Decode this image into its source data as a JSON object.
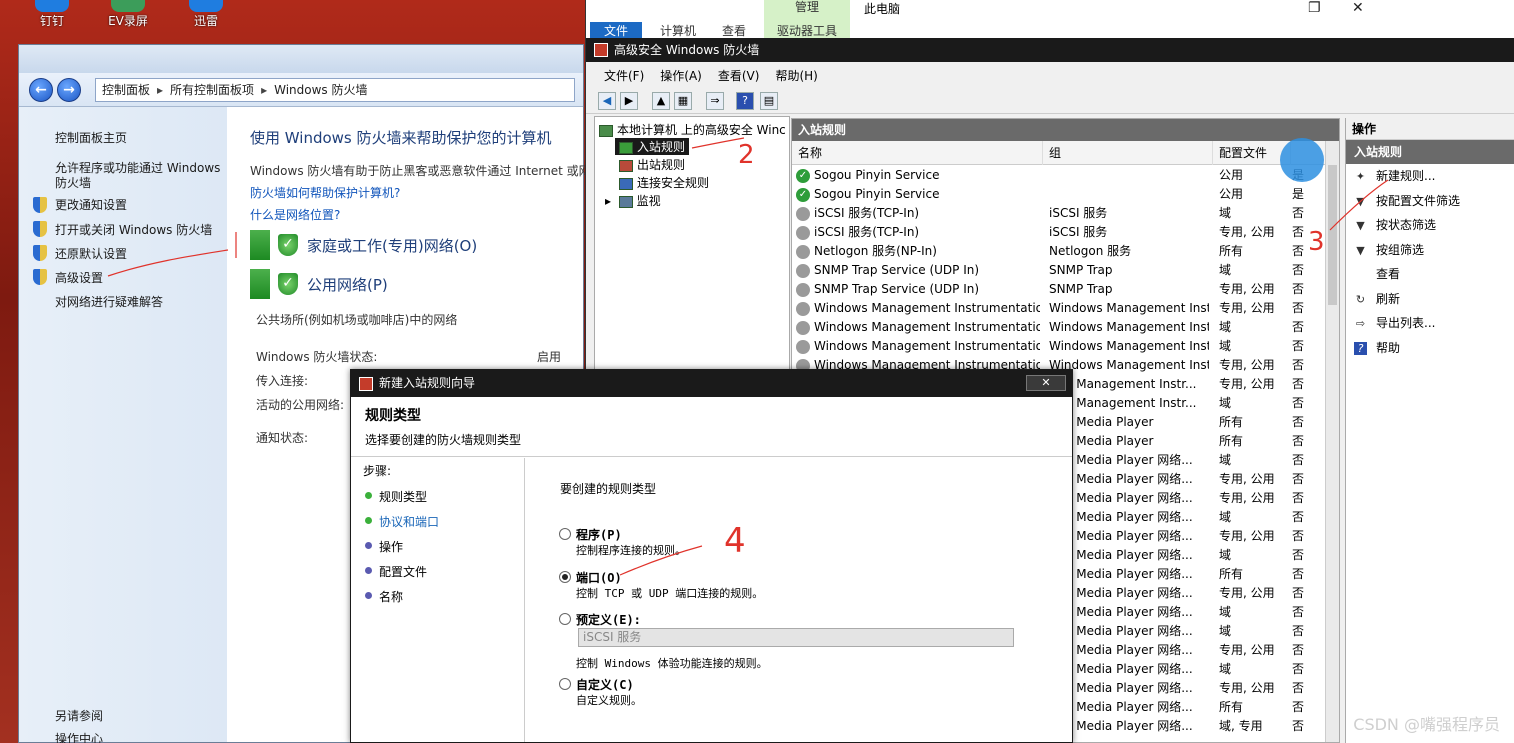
{
  "desktop": {
    "icons": [
      {
        "label": "钉钉"
      },
      {
        "label": "EV录屏"
      },
      {
        "label": "迅雷"
      }
    ]
  },
  "control_panel": {
    "breadcrumb": [
      "控制面板",
      "所有控制面板项",
      "Windows 防火墙"
    ],
    "left_links": [
      {
        "label": "控制面板主页",
        "shield": false
      },
      {
        "label": "允许程序或功能通过 Windows",
        "shield": false
      },
      {
        "label": "防火墙",
        "shield": false
      },
      {
        "label": "更改通知设置",
        "shield": true
      },
      {
        "label": "打开或关闭 Windows 防火墙",
        "shield": true
      },
      {
        "label": "还原默认设置",
        "shield": true
      },
      {
        "label": "高级设置",
        "shield": true
      },
      {
        "label": "对网络进行疑难解答",
        "shield": false
      }
    ],
    "see_also": [
      "另请参阅",
      "操作中心"
    ],
    "heading": "使用 Windows 防火墙来帮助保护您的计算机",
    "intro": "Windows 防火墙有助于防止黑客或恶意软件通过 Internet 或网络",
    "link1": "防火墙如何帮助保护计算机?",
    "link2": "什么是网络位置?",
    "networks": [
      {
        "name": "家庭或工作(专用)网络(O)"
      },
      {
        "name": "公用网络(P)"
      }
    ],
    "public_desc": "公共场所(例如机场或咖啡店)中的网络",
    "status_rows": [
      {
        "label": "Windows 防火墙状态:",
        "value": "启用"
      },
      {
        "label": "传入连接:",
        "value": ""
      },
      {
        "label": "活动的公用网络:",
        "value": ""
      },
      {
        "label": "通知状态:",
        "value": ""
      }
    ]
  },
  "explorer": {
    "tabs": [
      "文件",
      "计算机",
      "查看",
      "驱动器工具"
    ],
    "manage": "管理",
    "title": "此电脑"
  },
  "mmc": {
    "title": "高级安全 Windows 防火墙",
    "menu": [
      "文件(F)",
      "操作(A)",
      "查看(V)",
      "帮助(H)"
    ],
    "tree": {
      "root": "本地计算机 上的高级安全 Winc",
      "items": [
        "入站规则",
        "出站规则",
        "连接安全规则",
        "监视"
      ]
    },
    "list": {
      "title": "入站规则",
      "columns": [
        "名称",
        "组",
        "配置文件",
        ""
      ],
      "rows": [
        {
          "enabled": true,
          "name": "Sogou Pinyin Service",
          "group": "",
          "profile": "公用",
          "on": "是"
        },
        {
          "enabled": true,
          "name": "Sogou Pinyin Service",
          "group": "",
          "profile": "公用",
          "on": "是"
        },
        {
          "enabled": false,
          "name": "iSCSI 服务(TCP-In)",
          "group": "iSCSI 服务",
          "profile": "域",
          "on": "否"
        },
        {
          "enabled": false,
          "name": "iSCSI 服务(TCP-In)",
          "group": "iSCSI 服务",
          "profile": "专用, 公用",
          "on": "否"
        },
        {
          "enabled": false,
          "name": "Netlogon 服务(NP-In)",
          "group": "Netlogon 服务",
          "profile": "所有",
          "on": "否"
        },
        {
          "enabled": false,
          "name": "SNMP Trap Service (UDP In)",
          "group": "SNMP Trap",
          "profile": "域",
          "on": "否"
        },
        {
          "enabled": false,
          "name": "SNMP Trap Service (UDP In)",
          "group": "SNMP Trap",
          "profile": "专用, 公用",
          "on": "否"
        },
        {
          "enabled": false,
          "name": "Windows Management Instrumentation ...",
          "group": "Windows Management Instr...",
          "profile": "专用, 公用",
          "on": "否"
        },
        {
          "enabled": false,
          "name": "Windows Management Instrumentation ...",
          "group": "Windows Management Instr...",
          "profile": "域",
          "on": "否"
        },
        {
          "enabled": false,
          "name": "Windows Management Instrumentation ...",
          "group": "Windows Management Instr...",
          "profile": "域",
          "on": "否"
        },
        {
          "enabled": false,
          "name": "Windows Management Instrumentation ...",
          "group": "Windows Management Instr...",
          "profile": "专用, 公用",
          "on": "否"
        },
        {
          "enabled": false,
          "name": "",
          "group": "ows Management Instr...",
          "profile": "专用, 公用",
          "on": "否"
        },
        {
          "enabled": false,
          "name": "",
          "group": "ows Management Instr...",
          "profile": "域",
          "on": "否"
        },
        {
          "enabled": false,
          "name": "",
          "group": "ows Media Player",
          "profile": "所有",
          "on": "否"
        },
        {
          "enabled": false,
          "name": "",
          "group": "ows Media Player",
          "profile": "所有",
          "on": "否"
        },
        {
          "enabled": false,
          "name": "",
          "group": "ows Media Player 网络...",
          "profile": "域",
          "on": "否"
        },
        {
          "enabled": false,
          "name": "",
          "group": "ows Media Player 网络...",
          "profile": "专用, 公用",
          "on": "否"
        },
        {
          "enabled": false,
          "name": "",
          "group": "ows Media Player 网络...",
          "profile": "专用, 公用",
          "on": "否"
        },
        {
          "enabled": false,
          "name": "",
          "group": "ows Media Player 网络...",
          "profile": "域",
          "on": "否"
        },
        {
          "enabled": false,
          "name": "",
          "group": "ows Media Player 网络...",
          "profile": "专用, 公用",
          "on": "否"
        },
        {
          "enabled": false,
          "name": "",
          "group": "ows Media Player 网络...",
          "profile": "域",
          "on": "否"
        },
        {
          "enabled": false,
          "name": "",
          "group": "ows Media Player 网络...",
          "profile": "所有",
          "on": "否"
        },
        {
          "enabled": false,
          "name": "",
          "group": "ows Media Player 网络...",
          "profile": "专用, 公用",
          "on": "否"
        },
        {
          "enabled": false,
          "name": "",
          "group": "ows Media Player 网络...",
          "profile": "域",
          "on": "否"
        },
        {
          "enabled": false,
          "name": "",
          "group": "ows Media Player 网络...",
          "profile": "域",
          "on": "否"
        },
        {
          "enabled": false,
          "name": "",
          "group": "ows Media Player 网络...",
          "profile": "专用, 公用",
          "on": "否"
        },
        {
          "enabled": false,
          "name": "",
          "group": "ows Media Player 网络...",
          "profile": "域",
          "on": "否"
        },
        {
          "enabled": false,
          "name": "",
          "group": "ows Media Player 网络...",
          "profile": "专用, 公用",
          "on": "否"
        },
        {
          "enabled": false,
          "name": "",
          "group": "ows Media Player 网络...",
          "profile": "所有",
          "on": "否"
        },
        {
          "enabled": false,
          "name": "",
          "group": "ows Media Player 网络...",
          "profile": "域, 专用",
          "on": "否"
        }
      ]
    },
    "actions": {
      "title": "操作",
      "section": "入站规则",
      "items": [
        {
          "label": "新建规则...",
          "icon": "new-rule-icon"
        },
        {
          "label": "按配置文件筛选",
          "icon": "filter-icon"
        },
        {
          "label": "按状态筛选",
          "icon": "filter-icon"
        },
        {
          "label": "按组筛选",
          "icon": "filter-icon"
        },
        {
          "label": "查看",
          "icon": "view-icon"
        },
        {
          "label": "刷新",
          "icon": "refresh-icon"
        },
        {
          "label": "导出列表...",
          "icon": "export-icon"
        },
        {
          "label": "帮助",
          "icon": "help-icon"
        }
      ]
    }
  },
  "wizard": {
    "title": "新建入站规则向导",
    "heading": "规则类型",
    "subheading": "选择要创建的防火墙规则类型",
    "steps_label": "步骤:",
    "steps": [
      {
        "label": "规则类型",
        "state": "done"
      },
      {
        "label": "协议和端口",
        "state": "current"
      },
      {
        "label": "操作",
        "state": "todo"
      },
      {
        "label": "配置文件",
        "state": "todo"
      },
      {
        "label": "名称",
        "state": "todo"
      }
    ],
    "question": "要创建的规则类型",
    "options": [
      {
        "label": "程序(P)",
        "desc": "控制程序连接的规则。",
        "checked": false
      },
      {
        "label": "端口(O)",
        "desc": "控制 TCP 或 UDP 端口连接的规则。",
        "checked": true
      },
      {
        "label": "预定义(E):",
        "desc": "控制 Windows 体验功能连接的规则。",
        "checked": false
      },
      {
        "label": "自定义(C)",
        "desc": "自定义规则。",
        "checked": false
      }
    ],
    "predefined_value": "iSCSI 服务"
  },
  "annotations": [
    "2",
    "3",
    "4"
  ],
  "watermark": "CSDN @嘴强程序员"
}
